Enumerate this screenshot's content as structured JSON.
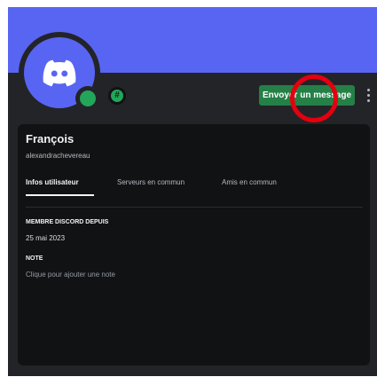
{
  "profile": {
    "display_name": "François",
    "username": "alexandrachevereau"
  },
  "header": {
    "avatar_icon": "discord-logo-icon",
    "status_icon": "online-status-icon",
    "badge_icon": "hashtag-badge-icon",
    "badge_symbol": "#",
    "send_message_label": "Envoyer un message",
    "more_icon": "more-vertical-icon"
  },
  "tabs": [
    {
      "label": "Infos utilisateur",
      "active": true
    },
    {
      "label": "Serveurs en commun",
      "active": false
    },
    {
      "label": "Amis en commun",
      "active": false
    }
  ],
  "user_info": {
    "member_since_title": "MEMBRE DISCORD DEPUIS",
    "member_since_value": "25 mai 2023",
    "note_title": "NOTE",
    "note_placeholder": "Clique pour ajouter une note"
  },
  "colors": {
    "banner": "#5865f2",
    "card_background": "#232428",
    "panel_background": "#111214",
    "online_status": "#23a55a",
    "send_button": "#248046",
    "highlight_circle": "#e3000f"
  }
}
